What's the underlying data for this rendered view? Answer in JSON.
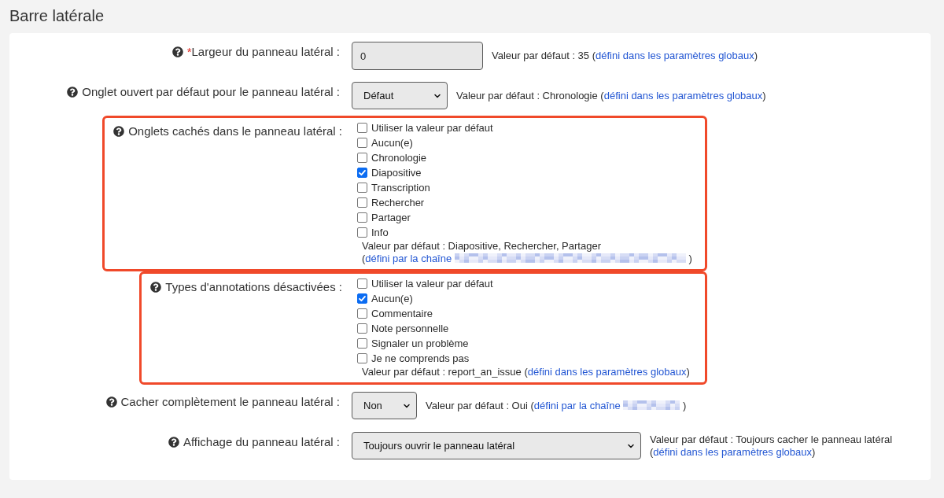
{
  "section": {
    "title": "Barre latérale"
  },
  "fields": [
    {
      "kind": "text",
      "required_mark": "*",
      "label": "Largeur du panneau latéral :",
      "value": "0",
      "highlighted": false,
      "note": {
        "text": "Valeur par défaut : 35",
        "link_open": "(",
        "link": "défini dans les paramètres globaux",
        "link_close": ")"
      }
    },
    {
      "kind": "select",
      "label": "Onglet ouvert par défaut pour le panneau latéral :",
      "value": "Défaut",
      "highlighted": false,
      "note": {
        "text": "Valeur par défaut : Chronologie",
        "link_open": "(",
        "link": "défini dans les paramètres globaux",
        "link_close": ")"
      }
    },
    {
      "kind": "checkboxes",
      "label": "Onglets cachés dans le panneau latéral :",
      "highlighted": true,
      "options": [
        {
          "label": "Utiliser la valeur par défaut",
          "checked": false
        },
        {
          "label": "Aucun(e)",
          "checked": false
        },
        {
          "label": "Chronologie",
          "checked": false
        },
        {
          "label": "Diapositive",
          "checked": true
        },
        {
          "label": "Transcription",
          "checked": false
        },
        {
          "label": "Rechercher",
          "checked": false
        },
        {
          "label": "Partager",
          "checked": false
        },
        {
          "label": "Info",
          "checked": false
        }
      ],
      "note": {
        "text": "Valeur par défaut : Diapositive, Rechercher, Partager",
        "link_open": "(",
        "link": "défini par la chaîne",
        "redacted": true,
        "link_close": ")"
      }
    },
    {
      "kind": "checkboxes",
      "label": "Types d'annotations désactivées :",
      "highlighted": true,
      "options": [
        {
          "label": "Utiliser la valeur par défaut",
          "checked": false
        },
        {
          "label": "Aucun(e)",
          "checked": true
        },
        {
          "label": "Commentaire",
          "checked": false
        },
        {
          "label": "Note personnelle",
          "checked": false
        },
        {
          "label": "Signaler un problème",
          "checked": false
        },
        {
          "label": "Je ne comprends pas",
          "checked": false
        }
      ],
      "note": {
        "text": "Valeur par défaut : report_an_issue",
        "link_open": "(",
        "link": "défini dans les paramètres globaux",
        "link_close": ")"
      }
    },
    {
      "kind": "select",
      "label": "Cacher complètement le panneau latéral :",
      "value": "Non",
      "highlighted": false,
      "note": {
        "text": "Valeur par défaut : Oui",
        "link_open": "(",
        "link": "défini par la chaîne",
        "redacted": true,
        "link_close": ")"
      }
    },
    {
      "kind": "select",
      "label": "Affichage du panneau latéral :",
      "value": "Toujours ouvrir le panneau latéral",
      "highlighted": false,
      "note": {
        "text": "Valeur par défaut : Toujours cacher le panneau latéral",
        "link_open": "(",
        "link": "défini dans les paramètres globaux",
        "link_close": ")"
      }
    }
  ]
}
